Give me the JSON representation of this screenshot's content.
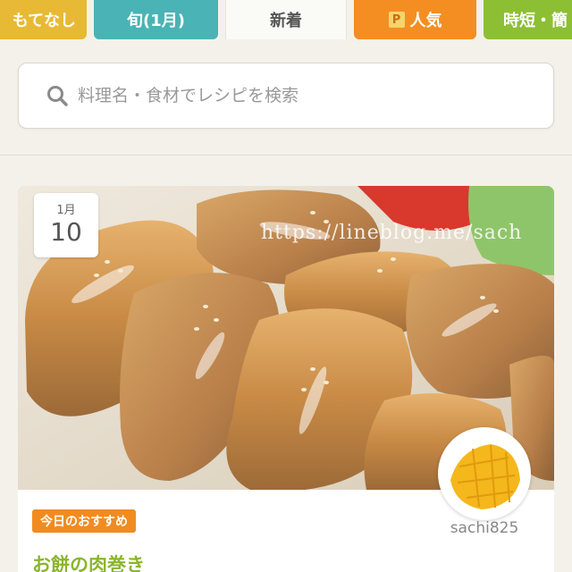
{
  "tabs": [
    {
      "label": "もてなし",
      "color": "#e7b934"
    },
    {
      "label": "旬(1月)",
      "color": "#4ab3b5"
    },
    {
      "label": "新着",
      "color": "#fafaf7",
      "active": true
    },
    {
      "label": "人気",
      "badge": "P",
      "color": "#f48e22"
    },
    {
      "label": "時短・簡",
      "color": "#8cbf34"
    }
  ],
  "search": {
    "placeholder": "料理名・食材でレシピを検索",
    "icon": "search-icon"
  },
  "card": {
    "date": {
      "month": "1月",
      "day": "10"
    },
    "watermark": "https://lineblog.me/sach",
    "author": "sachi825",
    "badge": "今日のおすすめ",
    "title": "お餅の肉巻き",
    "badge_color": "#f28b1f",
    "title_color": "#8ab52e"
  }
}
